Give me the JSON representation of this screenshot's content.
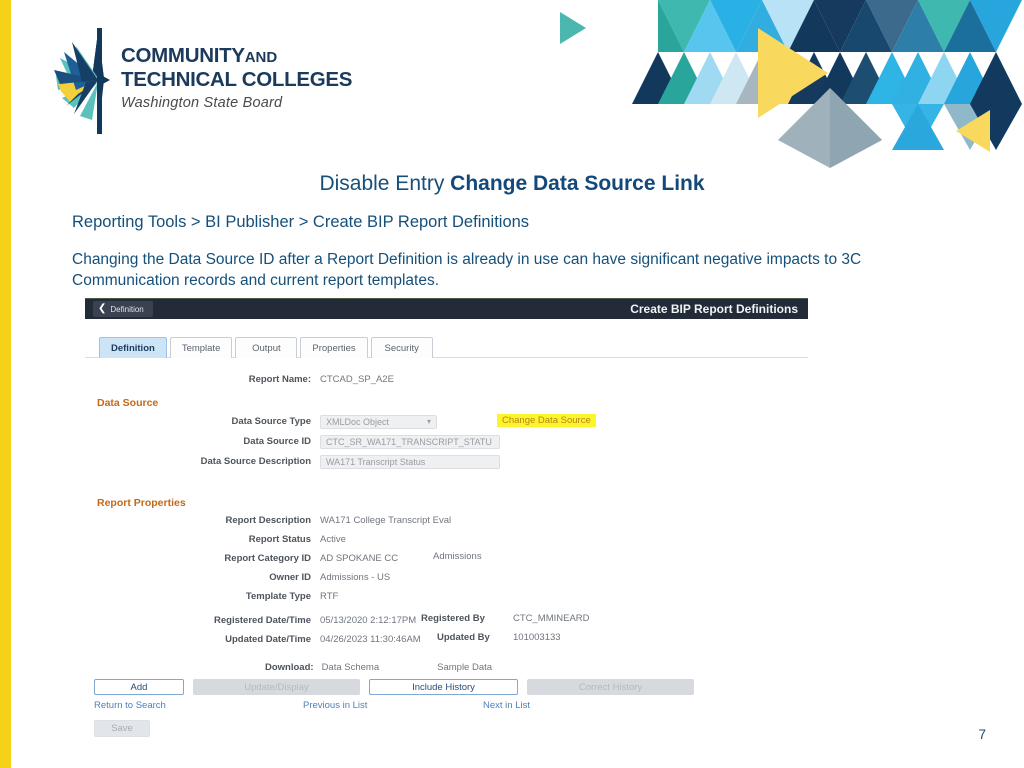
{
  "brand": {
    "logo_line1_main": "COMMUNITY",
    "logo_line1_small": "AND",
    "logo_line2": "TECHNICAL COLLEGES",
    "logo_line3": "Washington State Board",
    "accent_yellow": "#f5d117",
    "navy": "#1b3a5c",
    "title_blue": "#15507a"
  },
  "slide": {
    "title_regular": "Disable Entry ",
    "title_bold": "Change Data Source Link",
    "breadcrumb": "Reporting Tools > BI Publisher > Create BIP Report Definitions",
    "body": "Changing the Data Source ID after a Report Definition is already in use can have significant negative impacts to 3C Communication records and current report templates.",
    "page_number": "7"
  },
  "screenshot": {
    "header": {
      "back_label": "Definition",
      "back_icon": "chevron-left-icon",
      "title": "Create BIP Report Definitions"
    },
    "tabs": [
      {
        "label": "Definition",
        "accel": "D",
        "active": true
      },
      {
        "label": "Template",
        "accel": "T",
        "active": false
      },
      {
        "label": "Output",
        "accel": "O",
        "active": false
      },
      {
        "label": "Properties",
        "accel": "P",
        "active": false
      },
      {
        "label": "Security",
        "accel": "S",
        "active": false
      }
    ],
    "report_name": {
      "label": "Report Name:",
      "value": "CTCAD_SP_A2E"
    },
    "data_source": {
      "heading": "Data Source",
      "type_label": "Data Source Type",
      "type_value": "XMLDoc Object",
      "id_label": "Data Source ID",
      "id_value": "CTC_SR_WA171_TRANSCRIPT_STATU",
      "desc_label": "Data Source Description",
      "desc_value": "WA171 Transcript Status",
      "change_link": "Change Data Source",
      "highlight_color": "#fcf52a"
    },
    "report_properties": {
      "heading": "Report Properties",
      "rows": [
        {
          "label": "Report Description",
          "value": "WA171 College Transcript Eval"
        },
        {
          "label": "Report Status",
          "value": "Active"
        },
        {
          "label": "Report Category ID",
          "value": "AD SPOKANE CC",
          "extra": "Admissions"
        },
        {
          "label": "Owner ID",
          "value": "Admissions - US"
        },
        {
          "label": "Template Type",
          "value": "RTF"
        }
      ],
      "registered": {
        "label": "Registered Date/Time",
        "value": "05/13/2020  2:12:17PM",
        "by_label": "Registered By",
        "by_value": "CTC_MMINEARD"
      },
      "updated": {
        "label": "Updated Date/Time",
        "value": "04/26/2023 11:30:46AM",
        "by_label": "Updated By",
        "by_value": "101003133"
      }
    },
    "download": {
      "label": "Download:",
      "data_schema": "Data Schema",
      "sample_data": "Sample Data"
    },
    "buttons": {
      "add": "Add",
      "update_display": "Update/Display",
      "include_history": "Include History",
      "correct_history": "Correct History",
      "save": "Save"
    },
    "links": {
      "return_to_search": "Return to Search",
      "previous_in_list": "Previous in List",
      "next_in_list": "Next in List"
    }
  }
}
